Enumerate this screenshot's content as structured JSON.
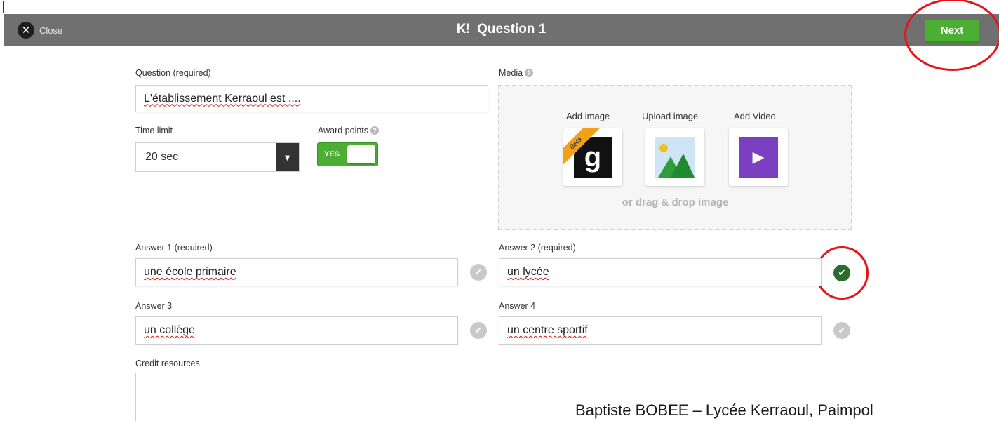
{
  "header": {
    "close_label": "Close",
    "close_icon": "close-icon",
    "logo": "K!",
    "title": "Question 1",
    "next_label": "Next",
    "bar_color": "#707070",
    "accent_green": "#4cae33"
  },
  "question": {
    "label": "Question (required)",
    "value": "L'établissement Kerraoul est ...."
  },
  "time_limit": {
    "label": "Time limit",
    "value": "20 sec",
    "arrow": "▼"
  },
  "award_points": {
    "label": "Award points",
    "help": "?",
    "toggle_text": "YES",
    "on": true
  },
  "media": {
    "label": "Media",
    "help": "?",
    "options": [
      {
        "label": "Add image",
        "icon": "getty-g-icon",
        "glyph": "g",
        "badge": "Beta"
      },
      {
        "label": "Upload image",
        "icon": "image-landscape-icon"
      },
      {
        "label": "Add Video",
        "icon": "video-play-icon",
        "glyph": "▶"
      }
    ],
    "drag_text": "or drag & drop image"
  },
  "answers": [
    {
      "label": "Answer 1 (required)",
      "value": "une école primaire",
      "correct": false
    },
    {
      "label": "Answer 2 (required)",
      "value": "un lycée",
      "correct": true
    },
    {
      "label": "Answer 3",
      "value": "un collège",
      "correct": false
    },
    {
      "label": "Answer 4",
      "value": "un centre sportif",
      "correct": false
    }
  ],
  "check_glyph": "✔",
  "credit": {
    "label": "Credit resources",
    "value": ""
  },
  "watermark": "Baptiste BOBEE – Lycée Kerraoul, Paimpol",
  "annotation_color": "#e3141b"
}
